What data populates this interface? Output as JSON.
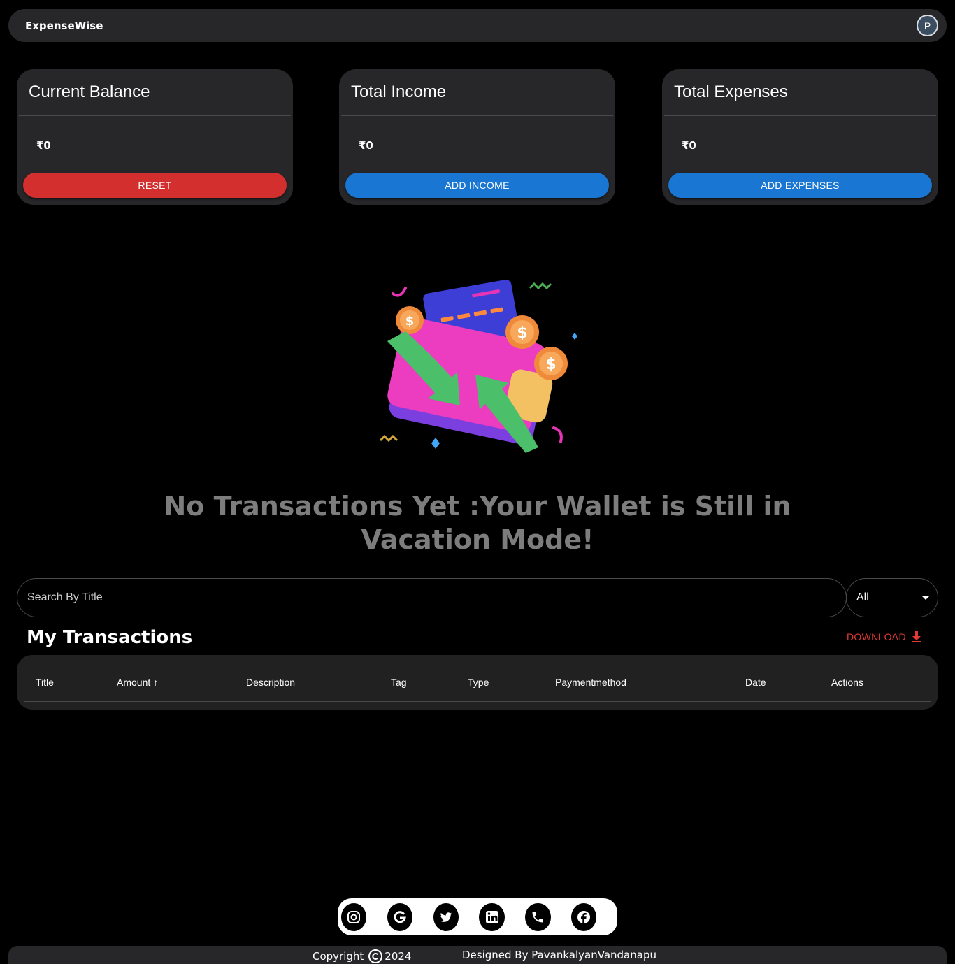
{
  "app": {
    "brand": "ExpenseWise",
    "avatar_letter": "P"
  },
  "cards": [
    {
      "title": "Current Balance",
      "value": "₹0",
      "button": "RESET",
      "button_color": "#d32f2f"
    },
    {
      "title": "Total Income",
      "value": "₹0",
      "button": "ADD INCOME",
      "button_color": "#1976d2"
    },
    {
      "title": "Total Expenses",
      "value": "₹0",
      "button": "ADD EXPENSES",
      "button_color": "#1976d2"
    }
  ],
  "empty_state": {
    "message": "No Transactions Yet :Your Wallet is Still in Vacation Mode!",
    "illustration": "wallet-transactions-illustration"
  },
  "search": {
    "placeholder": "Search By Title",
    "filter_value": "All"
  },
  "transactions": {
    "title": "My Transactions",
    "download_label": "DOWNLOAD",
    "columns": [
      "Title",
      "Amount ↑",
      "Description",
      "Tag",
      "Type",
      "Paymentmethod",
      "Date",
      "Actions"
    ],
    "rows": []
  },
  "social": [
    "instagram-icon",
    "google-icon",
    "twitter-icon",
    "linkedin-icon",
    "phone-icon",
    "facebook-icon"
  ],
  "footer": {
    "copyright_label": "Copyright",
    "year": "2024",
    "credit": "Designed By PavankalyanVandanapu"
  },
  "colors": {
    "accent_blue": "#1976d2",
    "accent_red": "#d32f2f",
    "download_red": "#e53935"
  }
}
